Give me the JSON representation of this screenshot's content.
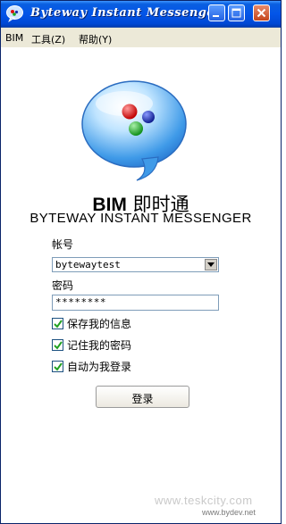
{
  "window": {
    "title": "Byteway Instant Messenger"
  },
  "menu": {
    "items": [
      {
        "label": "BIM"
      },
      {
        "label": "工具(Z)"
      },
      {
        "label": "帮助(Y)"
      }
    ]
  },
  "brand": {
    "name": "BIM",
    "name_cn": "即时通",
    "subtitle": "BYTEWAY INSTANT MESSENGER"
  },
  "form": {
    "account_label": "帐号",
    "account_value": "bytewaytest",
    "password_label": "密码",
    "password_value": "********",
    "checkboxes": [
      {
        "label": "保存我的信息",
        "checked": true
      },
      {
        "label": "记住我的密码",
        "checked": true
      },
      {
        "label": "自动为我登录",
        "checked": true
      }
    ],
    "login_label": "登录"
  },
  "watermarks": {
    "line1": "www.teskcity.com",
    "line2": "www.bydev.net"
  },
  "colors": {
    "titlebar": "#0355e8",
    "menubar": "#ece9d8",
    "logo_red": "#e01010",
    "logo_green": "#18a820",
    "logo_blue": "#1a2fa8"
  },
  "icons": {
    "app": "chat-bubble-icon",
    "minimize": "minimize-icon",
    "maximize": "maximize-icon",
    "close": "close-icon",
    "dropdown": "chevron-down-icon",
    "check": "checkmark-icon"
  }
}
